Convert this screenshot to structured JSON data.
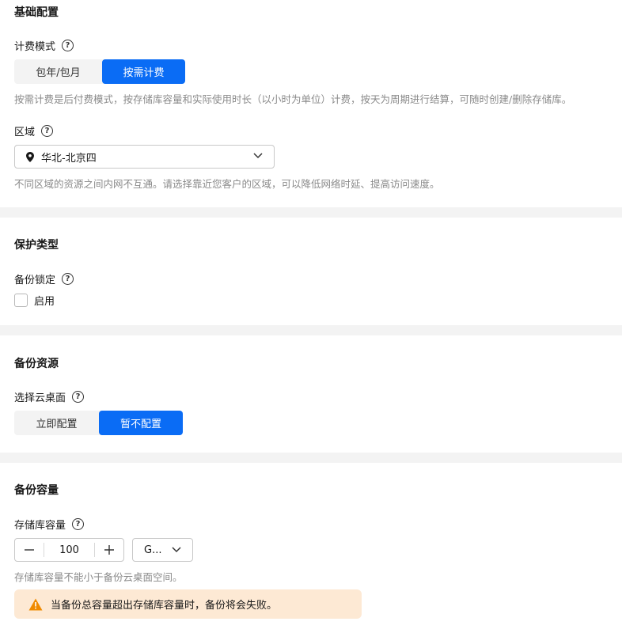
{
  "basic": {
    "title": "基础配置",
    "billing_label": "计费模式",
    "billing_options": [
      "包年/包月",
      "按需计费"
    ],
    "billing_selected": "按需计费",
    "billing_desc": "按需计费是后付费模式，按存储库容量和实际使用时长（以小时为单位）计费，按天为周期进行结算，可随时创建/删除存储库。",
    "region_label": "区域",
    "region_value": "华北-北京四",
    "region_desc": "不同区域的资源之间内网不互通。请选择靠近您客户的区域，可以降低网络时延、提高访问速度。"
  },
  "protection": {
    "title": "保护类型",
    "lock_label": "备份锁定",
    "enable_label": "启用",
    "enabled": false
  },
  "resources": {
    "title": "备份资源",
    "desktop_label": "选择云桌面",
    "options": [
      "立即配置",
      "暂不配置"
    ],
    "selected": "暂不配置"
  },
  "capacity": {
    "title": "备份容量",
    "vault_label": "存储库容量",
    "value": "100",
    "unit": "G...",
    "desc": "存储库容量不能小于备份云桌面空间。",
    "warning": "当备份总容量超出存储库容量时，备份将会失败。"
  },
  "help_glyph": "?",
  "colors": {
    "accent": "#0a6cf5",
    "warning_bg": "#fde9d4",
    "warning_icon": "#f08a00",
    "divider": "#f3f3f3"
  },
  "icons": {
    "help": "question-circle-icon",
    "region": "location-pin-icon",
    "dropdown": "chevron-down-icon",
    "decrement": "minus-icon",
    "increment": "plus-icon",
    "warning": "warning-triangle-icon"
  }
}
